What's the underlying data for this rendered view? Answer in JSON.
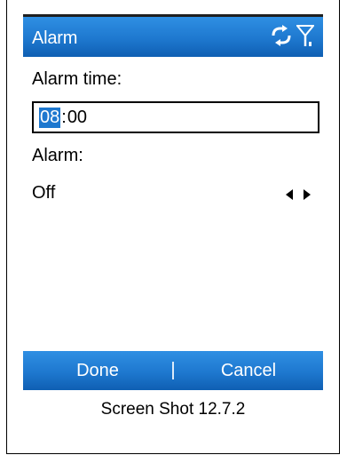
{
  "titlebar": {
    "title": "Alarm",
    "icons": [
      "connectivity-icon",
      "signal-strength-icon"
    ]
  },
  "form": {
    "alarm_time_label": "Alarm time:",
    "time_hours": "08",
    "time_separator": ":",
    "time_minutes": "00",
    "alarm_label": "Alarm:",
    "alarm_value": "Off",
    "arrow_icons": [
      "left-arrow-icon",
      "right-arrow-icon"
    ]
  },
  "softkeys": {
    "left": "Done",
    "right": "Cancel"
  },
  "caption": "Screen Shot 12.7.2",
  "colors": {
    "accent": "#1e78cf",
    "selection": "#1e78cf",
    "text": "#000000"
  }
}
